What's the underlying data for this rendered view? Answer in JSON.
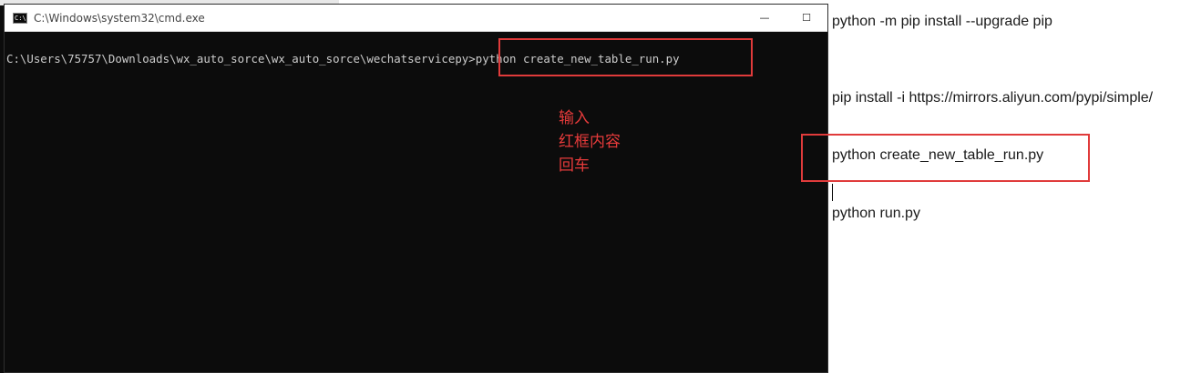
{
  "cmd": {
    "title": "C:\\Windows\\system32\\cmd.exe",
    "icon_label": "C:\\",
    "prompt_path": "C:\\Users\\75757\\Downloads\\wx_auto_sorce\\wx_auto_sorce\\wechatservicepy",
    "command": ">python create_new_table_run.py",
    "controls": {
      "minimize": "—",
      "maximize": "☐"
    }
  },
  "annotation": {
    "lines": [
      "输入",
      "红框内容",
      "回车"
    ]
  },
  "document": {
    "lines": [
      "python -m pip install --upgrade pip",
      "pip install -i https://mirrors.aliyun.com/pypi/simple/",
      "python create_new_table_run.py",
      "python run.py"
    ]
  },
  "colors": {
    "annotation_red": "#e03b3b",
    "terminal_bg": "#0c0c0c",
    "terminal_text": "#cccccc"
  }
}
